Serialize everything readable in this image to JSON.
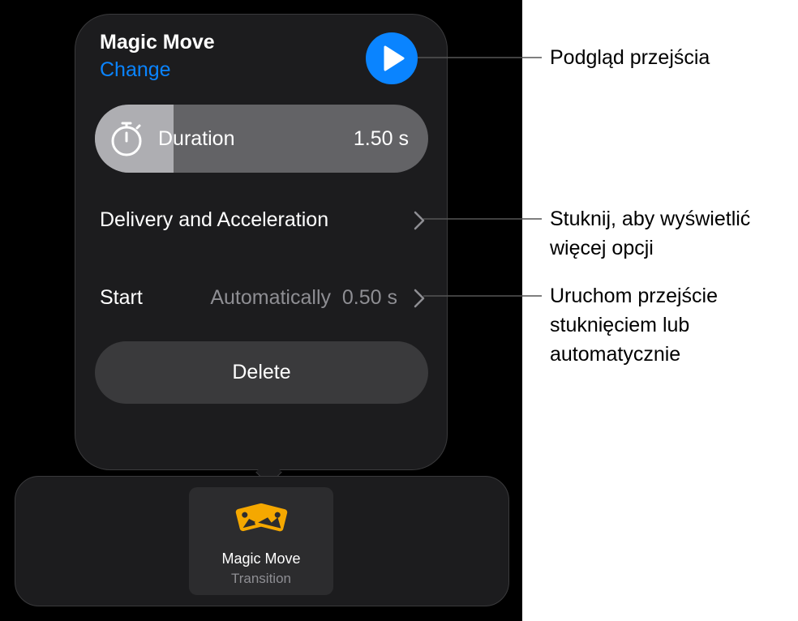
{
  "popover": {
    "title": "Magic Move",
    "change_label": "Change",
    "play_icon": "play-icon",
    "duration": {
      "label": "Duration",
      "value": "1.50 s",
      "slider_fraction": 0.235,
      "icon": "stopwatch-icon"
    },
    "delivery_row": {
      "label": "Delivery and Acceleration",
      "icon": "chevron-right-icon"
    },
    "start_row": {
      "label": "Start",
      "value": "Automatically  0.50 s",
      "icon": "chevron-right-icon"
    },
    "delete_label": "Delete"
  },
  "transition_tray": {
    "item": {
      "name": "Magic Move",
      "type": "Transition",
      "icon": "magic-move-icon"
    }
  },
  "callouts": {
    "play_preview": "Podgląd przejścia",
    "more_options": "Stuknij, aby wyświetlić\nwięcej opcji",
    "start_trigger": "Uruchom przejście\nstuknięciem lub\nautomatycznie"
  },
  "colors": {
    "accent": "#0a84ff",
    "popover_bg": "#1c1c1e",
    "icon_yellow": "#f5a800"
  }
}
